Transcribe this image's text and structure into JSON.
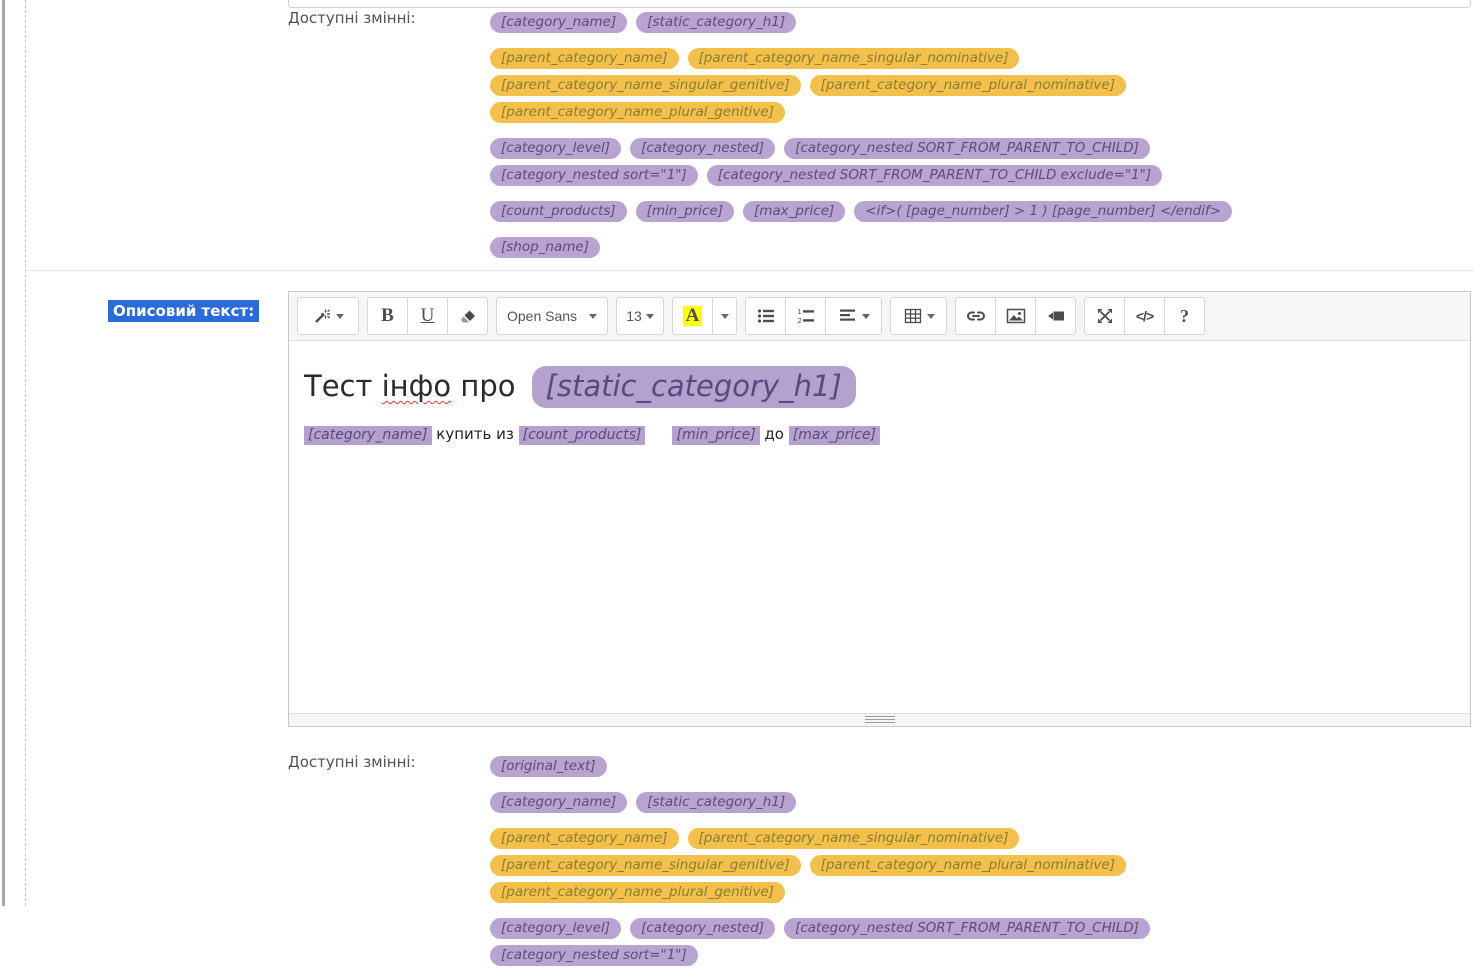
{
  "colors": {
    "purple_badge_bg": "#b9a3d0",
    "purple_badge_text": "#5f4a7a",
    "yellow_badge_bg": "#f3c14b",
    "yellow_badge_text": "#8a7c33",
    "selection_highlight": "#2a6bd9"
  },
  "top_variables": {
    "label": "Доступні змінні:",
    "groups": [
      {
        "color": "purple",
        "items": [
          "[category_name]",
          "[static_category_h1]"
        ]
      },
      {
        "color": "yellow",
        "items": [
          "[parent_category_name]",
          "[parent_category_name_singular_nominative]",
          "[parent_category_name_singular_genitive]",
          "[parent_category_name_plural_nominative]",
          "[parent_category_name_plural_genitive]"
        ]
      },
      {
        "color": "purple",
        "items": [
          "[category_level]",
          "[category_nested]",
          "[category_nested SORT_FROM_PARENT_TO_CHILD]",
          "[category_nested sort=\"1\"]",
          "[category_nested SORT_FROM_PARENT_TO_CHILD exclude=\"1\"]"
        ]
      },
      {
        "color": "purple",
        "items": [
          "[count_products]",
          "[min_price]",
          "[max_price]",
          "<if>( [page_number] > 1 ) [page_number] </endif>"
        ]
      },
      {
        "color": "purple",
        "items": [
          "[shop_name]"
        ]
      }
    ]
  },
  "editor": {
    "field_label": "Описовий текст:",
    "toolbar": {
      "bold_label": "B",
      "underline_label": "U",
      "font_family_value": "Open Sans",
      "font_size_value": "13",
      "forecolor_letter": "A",
      "code_label": "</>",
      "help_label": "?"
    },
    "content": {
      "heading": {
        "text_start": "Тест ",
        "misspelled_word": "інфо",
        "text_end": " про",
        "badge": "[static_category_h1]"
      },
      "paragraph_segments": [
        {
          "type": "badge",
          "text": "[category_name]"
        },
        {
          "type": "text",
          "text": " купить из "
        },
        {
          "type": "badge",
          "text": "[count_products]"
        },
        {
          "type": "gap"
        },
        {
          "type": "badge",
          "text": "[min_price]"
        },
        {
          "type": "text",
          "text": " до "
        },
        {
          "type": "badge",
          "text": "[max_price]"
        }
      ]
    }
  },
  "bottom_variables": {
    "label": "Доступні змінні:",
    "groups": [
      {
        "color": "purple",
        "items": [
          "[original_text]"
        ]
      },
      {
        "color": "purple",
        "items": [
          "[category_name]",
          "[static_category_h1]"
        ]
      },
      {
        "color": "yellow",
        "items": [
          "[parent_category_name]",
          "[parent_category_name_singular_nominative]",
          "[parent_category_name_singular_genitive]",
          "[parent_category_name_plural_nominative]",
          "[parent_category_name_plural_genitive]"
        ]
      },
      {
        "color": "purple",
        "items": [
          "[category_level]",
          "[category_nested]",
          "[category_nested SORT_FROM_PARENT_TO_CHILD]",
          "[category_nested sort=\"1\"]"
        ]
      }
    ]
  }
}
